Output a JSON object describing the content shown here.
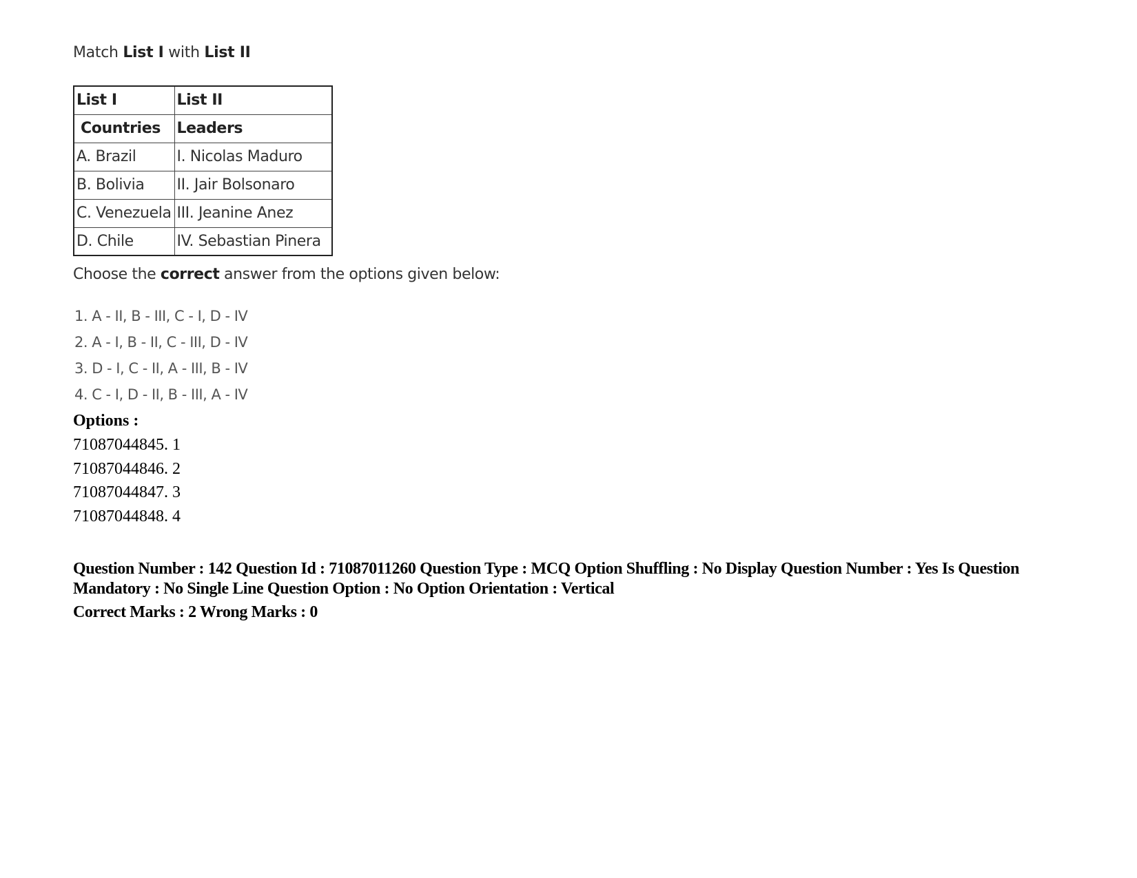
{
  "question": {
    "intro": {
      "prefix": "Match ",
      "list1": "List I",
      "middle": " with ",
      "list2": "List II"
    },
    "table": {
      "header": [
        "List I",
        "List II"
      ],
      "subheader": [
        "Countries",
        "Leaders"
      ],
      "rows": [
        [
          "A. Brazil",
          "I. Nicolas Maduro"
        ],
        [
          "B. Bolivia",
          "II. Jair Bolsonaro"
        ],
        [
          "C. Venezuela",
          "III. Jeanine Anez"
        ],
        [
          "D. Chile",
          "IV. Sebastian Pinera"
        ]
      ]
    },
    "choose": {
      "prefix": "Choose the ",
      "emphasis": "correct",
      "suffix": " answer from the options given below:"
    },
    "answers": [
      "1. A - II, B - III, C - I, D - IV",
      "2. A - I, B - II, C - III, D - IV",
      "3. D - I, C - II, A  - III, B - IV",
      "4. C - I, D  - II, B - III, A - IV"
    ]
  },
  "options": {
    "label": "Options :",
    "items": [
      "71087044845. 1",
      "71087044846. 2",
      "71087044847. 3",
      "71087044848. 4"
    ]
  },
  "meta": {
    "text": "Question Number : 142 Question Id : 71087011260 Question Type : MCQ Option Shuffling : No Display Question Number : Yes Is Question Mandatory : No Single Line Question Option : No Option Orientation : Vertical",
    "marks": "Correct Marks : 2 Wrong Marks : 0"
  }
}
